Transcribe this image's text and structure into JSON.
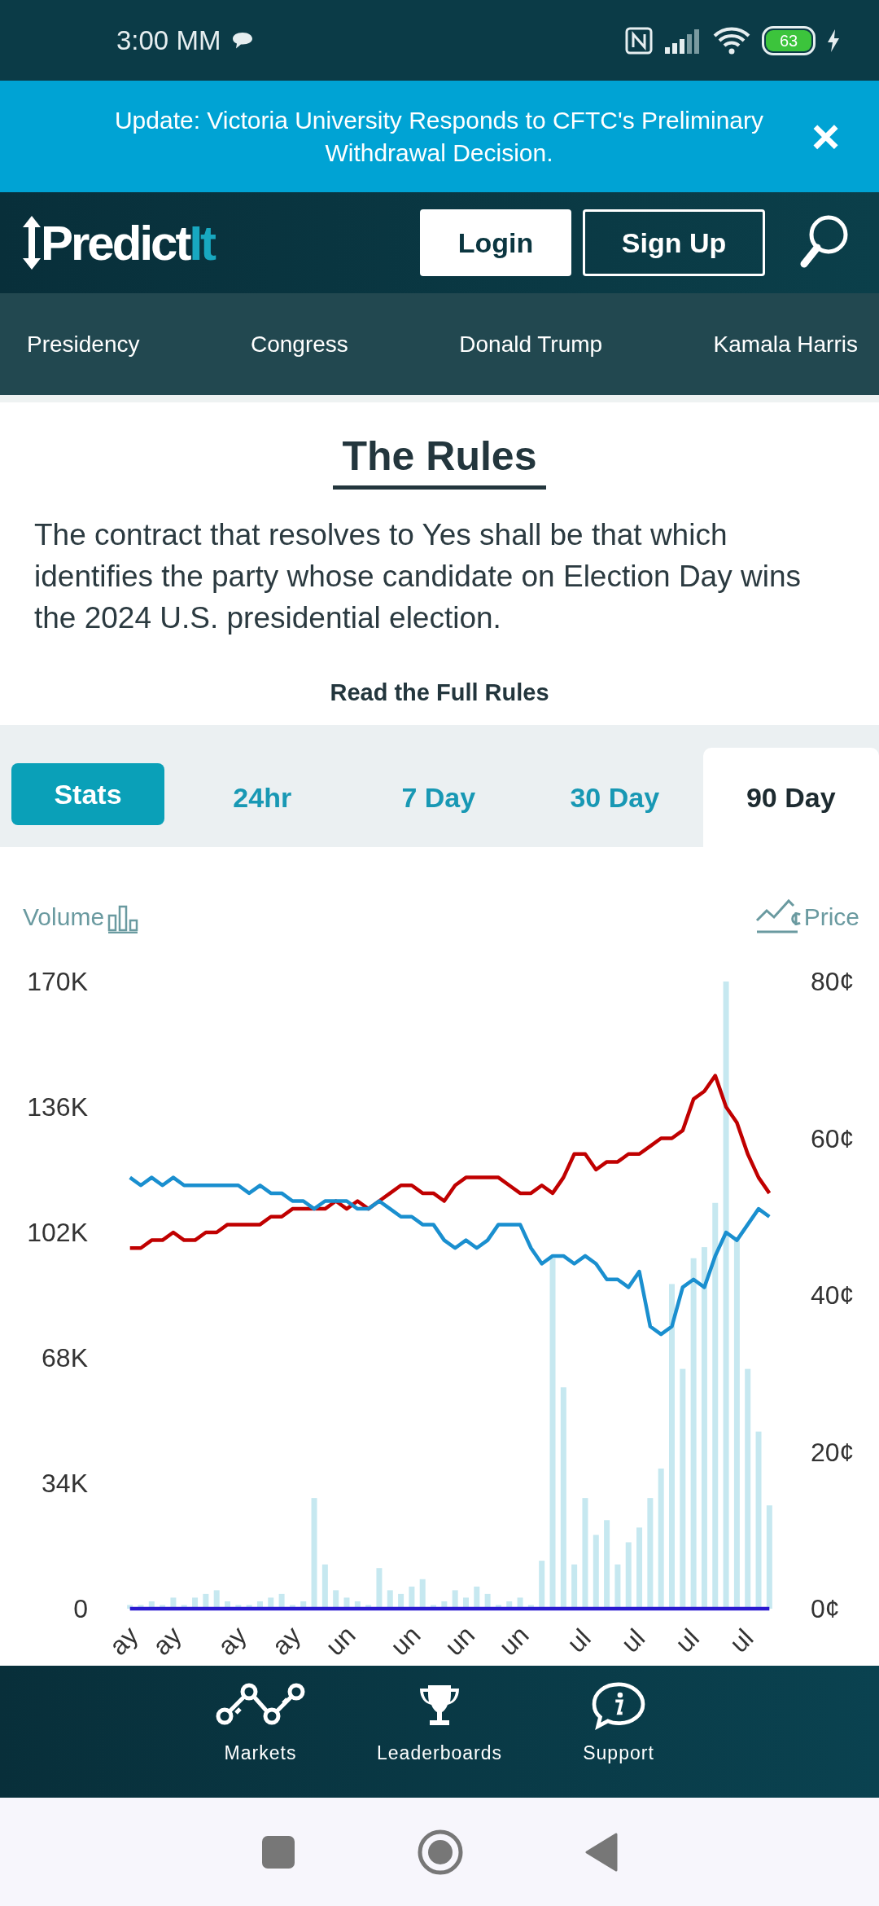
{
  "status_bar": {
    "time": "3:00 MM",
    "battery": "63"
  },
  "banner": {
    "text": "Update: Victoria University Responds to CFTC's Preliminary Withdrawal Decision.",
    "close": "×"
  },
  "header": {
    "logo_main": "Predict",
    "logo_accent": "It",
    "login": "Login",
    "signup": "Sign Up"
  },
  "categories": [
    "Presidency",
    "Congress",
    "Donald Trump",
    "Kamala Harris"
  ],
  "rules": {
    "title": "The Rules",
    "text": "The contract that resolves to Yes shall be that which identifies the party whose candidate on Election Day wins the 2024 U.S. presidential election.",
    "link": "Read the Full Rules"
  },
  "stats_button": "Stats",
  "range_tabs": [
    {
      "label": "24hr",
      "selected": false
    },
    {
      "label": "7 Day",
      "selected": false
    },
    {
      "label": "30 Day",
      "selected": false
    },
    {
      "label": "90 Day",
      "selected": true
    }
  ],
  "volume_chart": {
    "chart_data": {
      "type": "bar",
      "ylabel": "Volume",
      "categories": [
        "ay",
        null,
        null,
        null,
        "ay",
        null,
        null,
        null,
        null,
        null,
        "ay",
        null,
        null,
        null,
        null,
        "ay",
        null,
        null,
        null,
        null,
        "un",
        null,
        null,
        null,
        null,
        null,
        "un",
        null,
        null,
        null,
        null,
        "un",
        null,
        null,
        null,
        null,
        "un",
        null,
        null,
        null,
        null,
        null,
        "ul",
        null,
        null,
        null,
        null,
        "ul",
        null,
        null,
        null,
        null,
        "ul",
        null,
        null,
        null,
        null,
        "ul",
        null,
        null
      ],
      "ylim": [
        0,
        170000
      ],
      "yticks": [
        {
          "value": 0,
          "label": "0"
        },
        {
          "value": 34000,
          "label": "34K"
        },
        {
          "value": 68000,
          "label": "68K"
        },
        {
          "value": 102000,
          "label": "102K"
        },
        {
          "value": 136000,
          "label": "136K"
        },
        {
          "value": 170000,
          "label": "170K"
        }
      ],
      "series": [
        {
          "color": "#c6e8f0",
          "values": [
            1000,
            1000,
            2000,
            1000,
            3000,
            1000,
            3000,
            4000,
            5000,
            2000,
            1000,
            1000,
            2000,
            3000,
            4000,
            1000,
            2000,
            30000,
            12000,
            5000,
            3000,
            2000,
            1000,
            11000,
            5000,
            4000,
            6000,
            8000,
            1000,
            2000,
            5000,
            3000,
            6000,
            4000,
            1000,
            2000,
            3000,
            1000,
            13000,
            95000,
            60000,
            12000,
            30000,
            20000,
            24000,
            12000,
            18000,
            22000,
            30000,
            38000,
            88000,
            65000,
            95000,
            98000,
            110000,
            170000,
            100000,
            65000,
            48000,
            28000
          ]
        }
      ]
    }
  },
  "price_chart": {
    "chart_data": {
      "type": "line",
      "ylabel": "Price",
      "categories": [
        null,
        null,
        null,
        null,
        null,
        null,
        null,
        null,
        null,
        null,
        null,
        null,
        null,
        null,
        null,
        null,
        null,
        null,
        null,
        null,
        null,
        null,
        null,
        null,
        null,
        null,
        null,
        null,
        null,
        null,
        null,
        null,
        null,
        null,
        null,
        null,
        null,
        null,
        null,
        null,
        null,
        null,
        null,
        null,
        null,
        null,
        null,
        null,
        null,
        null,
        null,
        null,
        null,
        null,
        null,
        null,
        null,
        null,
        null,
        null
      ],
      "ylim": [
        0,
        80
      ],
      "yticks": [
        {
          "value": 0,
          "label": "0¢"
        },
        {
          "value": 20,
          "label": "20¢"
        },
        {
          "value": 40,
          "label": "40¢"
        },
        {
          "value": 60,
          "label": "60¢"
        },
        {
          "value": 80,
          "label": "80¢"
        }
      ],
      "series": [
        {
          "color": "#c00000",
          "values": [
            46,
            46,
            47,
            47,
            48,
            47,
            47,
            48,
            48,
            49,
            49,
            49,
            49,
            50,
            50,
            51,
            51,
            51,
            51,
            52,
            51,
            52,
            51,
            52,
            53,
            54,
            54,
            53,
            53,
            52,
            54,
            55,
            55,
            55,
            55,
            54,
            53,
            53,
            54,
            53,
            55,
            58,
            58,
            56,
            57,
            57,
            58,
            58,
            59,
            60,
            60,
            61,
            65,
            66,
            68,
            64,
            62,
            58,
            55,
            53
          ]
        },
        {
          "color": "#1a8fcf",
          "values": [
            55,
            54,
            55,
            54,
            55,
            54,
            54,
            54,
            54,
            54,
            54,
            53,
            54,
            53,
            53,
            52,
            52,
            51,
            52,
            52,
            52,
            51,
            51,
            52,
            51,
            50,
            50,
            49,
            49,
            47,
            46,
            47,
            46,
            47,
            49,
            49,
            49,
            46,
            44,
            45,
            45,
            44,
            45,
            44,
            42,
            42,
            41,
            43,
            36,
            35,
            36,
            41,
            42,
            41,
            45,
            48,
            47,
            49,
            51,
            50
          ]
        },
        {
          "color": "#2a1ad0",
          "values": [
            0,
            0,
            0,
            0,
            0,
            0,
            0,
            0,
            0,
            0,
            0,
            0,
            0,
            0,
            0,
            0,
            0,
            0,
            0,
            0,
            0,
            0,
            0,
            0,
            0,
            0,
            0,
            0,
            0,
            0,
            0,
            0,
            0,
            0,
            0,
            0,
            0,
            0,
            0,
            0,
            0,
            0,
            0,
            0,
            0,
            0,
            0,
            0,
            0,
            0,
            0,
            0,
            0,
            0,
            0,
            0,
            0,
            0,
            0,
            0
          ]
        }
      ]
    }
  },
  "bottom_nav": [
    {
      "kind": "markets",
      "label": "Markets"
    },
    {
      "kind": "trophy",
      "label": "Leaderboards"
    },
    {
      "kind": "support",
      "label": "Support"
    }
  ]
}
